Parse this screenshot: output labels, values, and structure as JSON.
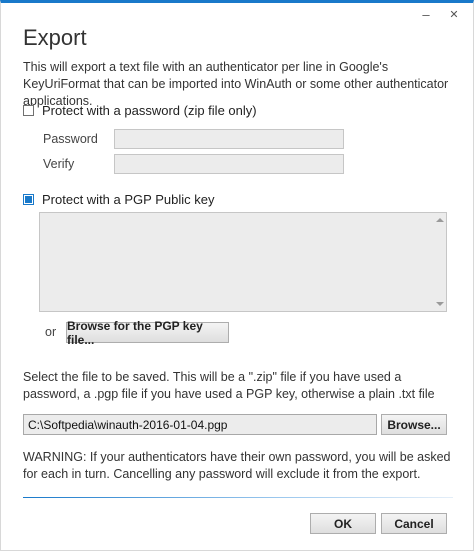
{
  "window": {
    "minimize_glyph": "–",
    "close_glyph": "✕"
  },
  "heading": "Export",
  "intro": "This will export a text file with an authenticator per line in Google's KeyUriFormat that can be imported into WinAuth or some other authenticator applications.",
  "password_section": {
    "checkbox_label": "Protect with a password (zip file only)",
    "checked": false,
    "password_label": "Password",
    "password_value": "",
    "verify_label": "Verify",
    "verify_value": ""
  },
  "pgp_section": {
    "checkbox_label": "Protect with a PGP Public key",
    "checked": true,
    "key_value": "",
    "or_label": "or",
    "browse_key_button": "Browse for the PGP key file..."
  },
  "file_section": {
    "description": "Select the file to be saved. This will be a \".zip\" file if you have used a password, a .pgp file if you have used a PGP key, otherwise a plain .txt file",
    "path_value": "C:\\Softpedia\\winauth-2016-01-04.pgp",
    "browse_button": "Browse..."
  },
  "warning": "WARNING: If your authenticators have their own password, you will be asked for each in turn. Cancelling any password will exclude it from the export.",
  "buttons": {
    "ok": "OK",
    "cancel": "Cancel"
  },
  "colors": {
    "accent": "#1979ca"
  }
}
